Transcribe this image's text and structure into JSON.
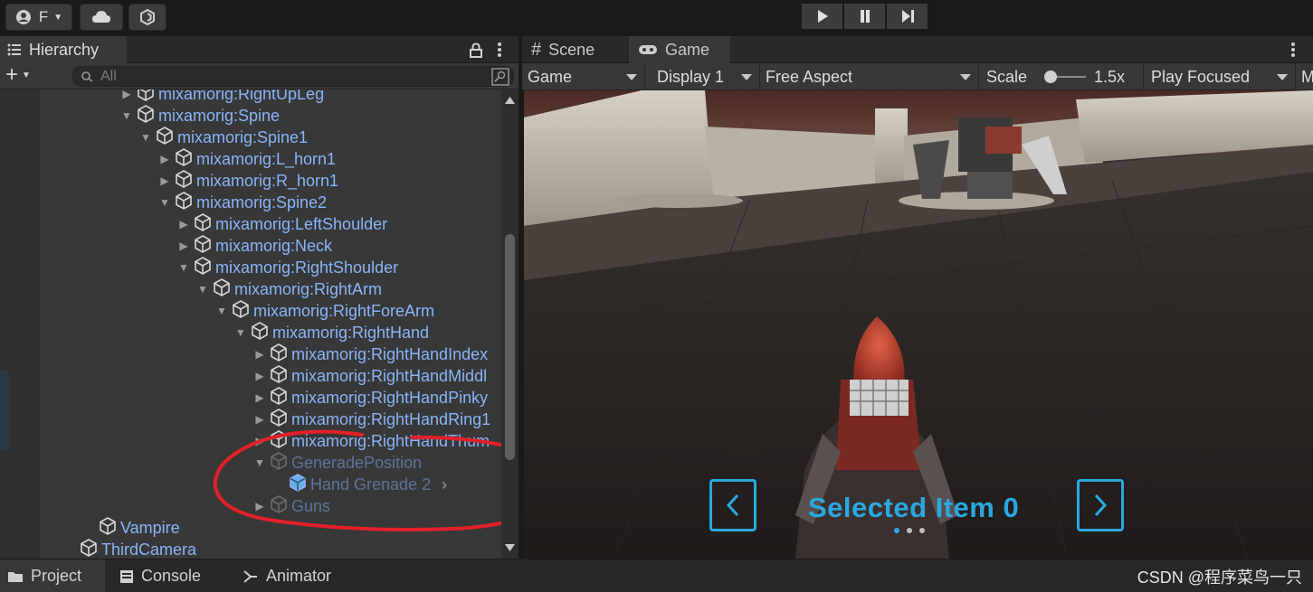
{
  "toolbar": {
    "account_initial": "F",
    "play_controls": [
      "play",
      "pause",
      "step"
    ]
  },
  "hierarchy": {
    "tab_label": "Hierarchy",
    "search_placeholder": "All",
    "rows": [
      {
        "label": "mixamorig:RightUpLeg",
        "depth": 0,
        "arrow": "right",
        "dim": false
      },
      {
        "label": "mixamorig:Spine",
        "depth": 0,
        "arrow": "down",
        "dim": false
      },
      {
        "label": "mixamorig:Spine1",
        "depth": 1,
        "arrow": "down",
        "dim": false
      },
      {
        "label": "mixamorig:L_horn1",
        "depth": 2,
        "arrow": "right",
        "dim": false
      },
      {
        "label": "mixamorig:R_horn1",
        "depth": 2,
        "arrow": "right",
        "dim": false
      },
      {
        "label": "mixamorig:Spine2",
        "depth": 2,
        "arrow": "down",
        "dim": false
      },
      {
        "label": "mixamorig:LeftShoulder",
        "depth": 3,
        "arrow": "right",
        "dim": false
      },
      {
        "label": "mixamorig:Neck",
        "depth": 3,
        "arrow": "right",
        "dim": false
      },
      {
        "label": "mixamorig:RightShoulder",
        "depth": 3,
        "arrow": "down",
        "dim": false
      },
      {
        "label": "mixamorig:RightArm",
        "depth": 4,
        "arrow": "down",
        "dim": false
      },
      {
        "label": "mixamorig:RightForeArm",
        "depth": 5,
        "arrow": "down",
        "dim": false
      },
      {
        "label": "mixamorig:RightHand",
        "depth": 6,
        "arrow": "down",
        "dim": false
      },
      {
        "label": "mixamorig:RightHandIndex",
        "depth": 7,
        "arrow": "right",
        "dim": false
      },
      {
        "label": "mixamorig:RightHandMiddl",
        "depth": 7,
        "arrow": "right",
        "dim": false
      },
      {
        "label": "mixamorig:RightHandPinky",
        "depth": 7,
        "arrow": "right",
        "dim": false
      },
      {
        "label": "mixamorig:RightHandRing1",
        "depth": 7,
        "arrow": "right",
        "dim": false
      },
      {
        "label": "mixamorig:RightHandThum",
        "depth": 7,
        "arrow": "right",
        "dim": false
      },
      {
        "label": "GeneradePosition",
        "depth": 7,
        "arrow": "down",
        "dim": true
      },
      {
        "label": "Hand Grenade 2",
        "depth": 8,
        "arrow": "",
        "dim": true,
        "prefab": true
      },
      {
        "label": "Guns",
        "depth": 7,
        "arrow": "right",
        "dim": true
      },
      {
        "label": "Vampire",
        "depth": -2,
        "arrow": "",
        "dim": false
      },
      {
        "label": "ThirdCamera",
        "depth": -3,
        "arrow": "",
        "dim": false
      }
    ]
  },
  "game": {
    "tabs": [
      {
        "label": "Scene",
        "icon": "grid-icon"
      },
      {
        "label": "Game",
        "icon": "gamepad-icon"
      }
    ],
    "active_tab": "Game",
    "options": {
      "mode": "Game",
      "display": "Display 1",
      "aspect": "Free Aspect",
      "scale_label": "Scale",
      "scale_value": "1.5x",
      "play_mode": "Play Focused",
      "overflow": "M"
    },
    "hud": {
      "selected_text": "Selected Item 0",
      "page_dots": 3,
      "active_dot": 0,
      "accent_color": "#2aa8e0"
    }
  },
  "bottom_tabs": [
    {
      "label": "Project",
      "icon": "folder-icon"
    },
    {
      "label": "Console",
      "icon": "console-icon"
    },
    {
      "label": "Animator",
      "icon": "animator-icon"
    }
  ],
  "watermark": "CSDN @程序菜鸟一只",
  "colors": {
    "hierarchy_text": "#8ab4f8",
    "annotation_red": "#e0202a",
    "panel_bg": "#383838"
  }
}
